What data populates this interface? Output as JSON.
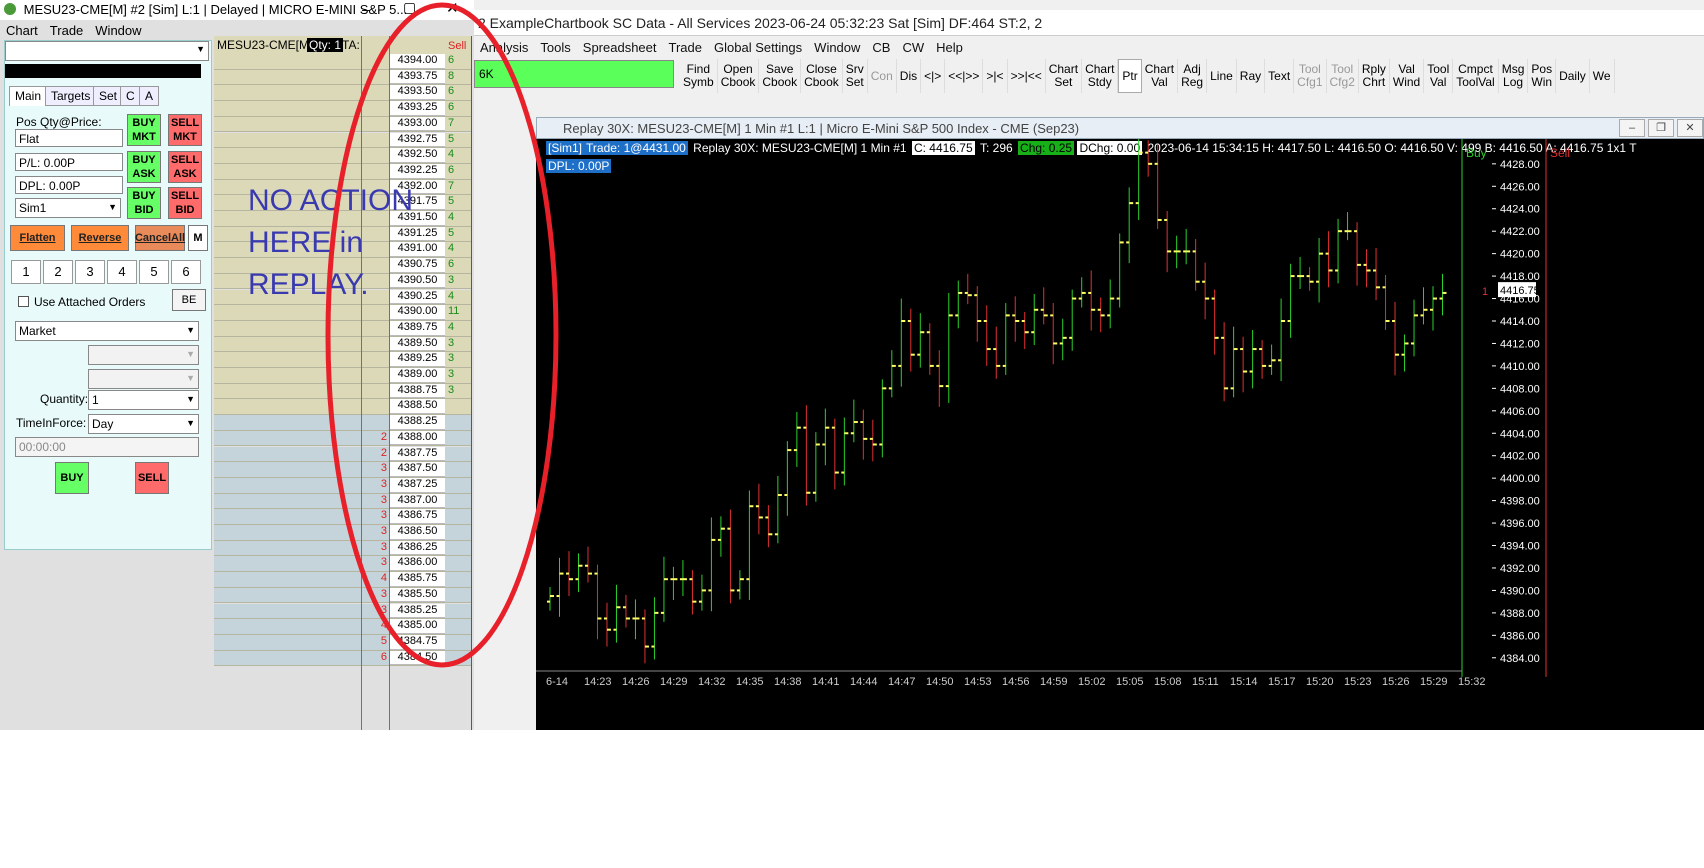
{
  "dom_window": {
    "title": "MESU23-CME[M] #2 [Sim]  L:1 | Delayed | MICRO E-MINI S&P 5...",
    "menu": [
      "Chart",
      "Trade",
      "Window"
    ],
    "header_symbol": "MESU23-CME[M]",
    "header_qty": "Qty: 1",
    "header_ta": "TA:",
    "sell_header": "Sell",
    "tabs": [
      "Main",
      "Targets",
      "Set",
      "C",
      "A"
    ],
    "pos_label": "Pos Qty@Price:",
    "pos_value": "Flat",
    "pl_value": "P/L: 0.00P",
    "dpl_value": "DPL: 0.00P",
    "account": "Sim1",
    "buy_mkt": "BUY MKT",
    "sell_mkt": "SELL MKT",
    "buy_ask": "BUY ASK",
    "sell_ask": "SELL ASK",
    "buy_bid": "BUY BID",
    "sell_bid": "SELL BID",
    "flatten": "Flatten",
    "reverse": "Reverse",
    "cancel_all": "CancelAll",
    "m_label": "M",
    "qty_buttons": [
      "1",
      "2",
      "3",
      "4",
      "5",
      "6"
    ],
    "attached_orders": "Use Attached Orders",
    "be_label": "BE",
    "order_type": "Market",
    "quantity_label": "Quantity:",
    "quantity_value": "1",
    "tif_label": "TimeInForce:",
    "tif_value": "Day",
    "time_value": "00:00:00",
    "buy": "BUY",
    "sell": "SELL",
    "note": [
      "NO ACTION",
      "HERE in",
      "REPLAY."
    ],
    "ladder_rows": [
      {
        "price": "4394.00",
        "ask": "6",
        "bid": ""
      },
      {
        "price": "4393.75",
        "ask": "8",
        "bid": ""
      },
      {
        "price": "4393.50",
        "ask": "6",
        "bid": ""
      },
      {
        "price": "4393.25",
        "ask": "6",
        "bid": ""
      },
      {
        "price": "4393.00",
        "ask": "7",
        "bid": ""
      },
      {
        "price": "4392.75",
        "ask": "5",
        "bid": ""
      },
      {
        "price": "4392.50",
        "ask": "4",
        "bid": ""
      },
      {
        "price": "4392.25",
        "ask": "6",
        "bid": ""
      },
      {
        "price": "4392.00",
        "ask": "7",
        "bid": ""
      },
      {
        "price": "4391.75",
        "ask": "5",
        "bid": ""
      },
      {
        "price": "4391.50",
        "ask": "4",
        "bid": ""
      },
      {
        "price": "4391.25",
        "ask": "5",
        "bid": ""
      },
      {
        "price": "4391.00",
        "ask": "4",
        "bid": ""
      },
      {
        "price": "4390.75",
        "ask": "6",
        "bid": ""
      },
      {
        "price": "4390.50",
        "ask": "3",
        "bid": ""
      },
      {
        "price": "4390.25",
        "ask": "4",
        "bid": ""
      },
      {
        "price": "4390.00",
        "ask": "11",
        "bid": ""
      },
      {
        "price": "4389.75",
        "ask": "4",
        "bid": ""
      },
      {
        "price": "4389.50",
        "ask": "3",
        "bid": ""
      },
      {
        "price": "4389.25",
        "ask": "3",
        "bid": ""
      },
      {
        "price": "4389.00",
        "ask": "3",
        "bid": ""
      },
      {
        "price": "4388.75",
        "ask": "3",
        "bid": ""
      },
      {
        "price": "4388.50",
        "ask": "",
        "bid": ""
      },
      {
        "price": "4388.25",
        "ask": "",
        "bid": ""
      },
      {
        "price": "4388.00",
        "ask": "",
        "bid": "2"
      },
      {
        "price": "4387.75",
        "ask": "",
        "bid": "2"
      },
      {
        "price": "4387.50",
        "ask": "",
        "bid": "3"
      },
      {
        "price": "4387.25",
        "ask": "",
        "bid": "3"
      },
      {
        "price": "4387.00",
        "ask": "",
        "bid": "3"
      },
      {
        "price": "4386.75",
        "ask": "",
        "bid": "3"
      },
      {
        "price": "4386.50",
        "ask": "",
        "bid": "3"
      },
      {
        "price": "4386.25",
        "ask": "",
        "bid": "3"
      },
      {
        "price": "4386.00",
        "ask": "",
        "bid": "3"
      },
      {
        "price": "4385.75",
        "ask": "",
        "bid": "4"
      },
      {
        "price": "4385.50",
        "ask": "",
        "bid": "3"
      },
      {
        "price": "4385.25",
        "ask": "",
        "bid": "3"
      },
      {
        "price": "4385.00",
        "ask": "",
        "bid": "4"
      },
      {
        "price": "4384.75",
        "ask": "",
        "bid": "5"
      },
      {
        "price": "4384.50",
        "ask": "",
        "bid": "6"
      }
    ]
  },
  "main_window": {
    "title": "2 ExampleChartbook SC Data - All Services 2023-06-24  05:32:23 Sat [Sim]  DF:464  ST:2, 2",
    "menu": [
      "Analysis",
      "Tools",
      "Spreadsheet",
      "Trade",
      "Global Settings",
      "Window",
      "CB",
      "CW",
      "Help"
    ],
    "green_box_text": "6K",
    "toolbar": [
      {
        "label": "Find\nSymb",
        "state": "normal"
      },
      {
        "label": "Open\nCbook",
        "state": "normal"
      },
      {
        "label": "Save\nCbook",
        "state": "normal"
      },
      {
        "label": "Close\nCbook",
        "state": "normal"
      },
      {
        "label": "Srv\nSet",
        "state": "normal"
      },
      {
        "label": "Con",
        "state": "disabled"
      },
      {
        "label": "Dis",
        "state": "normal"
      },
      {
        "label": "<|>",
        "state": "normal"
      },
      {
        "label": "<<|>>",
        "state": "normal"
      },
      {
        "label": ">|<",
        "state": "normal"
      },
      {
        "label": ">>|<<",
        "state": "normal"
      },
      {
        "label": "Chart\nSet",
        "state": "normal"
      },
      {
        "label": "Chart\nStdy",
        "state": "normal"
      },
      {
        "label": "Ptr",
        "state": "selected"
      },
      {
        "label": "Chart\nVal",
        "state": "normal"
      },
      {
        "label": "Adj\nReg",
        "state": "normal"
      },
      {
        "label": "Line",
        "state": "normal"
      },
      {
        "label": "Ray",
        "state": "normal"
      },
      {
        "label": "Text",
        "state": "normal"
      },
      {
        "label": "Tool\nCfg1",
        "state": "disabled"
      },
      {
        "label": "Tool\nCfg2",
        "state": "disabled"
      },
      {
        "label": "Rply\nChrt",
        "state": "normal"
      },
      {
        "label": "Val\nWind",
        "state": "normal"
      },
      {
        "label": "Tool\nVal",
        "state": "normal"
      },
      {
        "label": "Cmpct\nToolVal",
        "state": "normal"
      },
      {
        "label": "Msg\nLog",
        "state": "normal"
      },
      {
        "label": "Pos\nWin",
        "state": "normal"
      },
      {
        "label": "Daily",
        "state": "normal"
      },
      {
        "label": "We",
        "state": "normal"
      }
    ]
  },
  "chart_window": {
    "title": "Replay 30X: MESU23-CME[M]  1 Min  #1 L:1 | Micro E-Mini S&P 500 Index - CME (Sep23)",
    "info_sim": "[Sim1]",
    "info_trade": "Trade: 1@4431.00",
    "info_replay": "Replay 30X: MESU23-CME[M]  1 Min  #1",
    "info_c": "C: 4416.75",
    "info_t": "T: 296",
    "info_chg": "Chg: 0.25",
    "info_dchg": "DChg: 0.00",
    "info_rest": "2023-06-14 15:34:15 H: 4417.50 L: 4416.50 O: 4416.50 V: 499 B: 4416.50 A: 4416.75 1x1 T",
    "dpl": "DPL: 0.00P",
    "buy_label": "Buy",
    "sell_label": "Sell",
    "right_one": "1",
    "last_price": "4416.75",
    "date_label": "6-14",
    "colors": {
      "up": "#2bd12b",
      "down": "#e03030",
      "tick": "#ffff66"
    }
  },
  "chart_data": {
    "type": "ohlc",
    "title": "Replay 30X: MESU23-CME[M]  1 Min",
    "y_ticks": [
      "4428.00",
      "4426.00",
      "4424.00",
      "4422.00",
      "4420.00",
      "4418.00",
      "4416.00",
      "4414.00",
      "4412.00",
      "4410.00",
      "4408.00",
      "4406.00",
      "4404.00",
      "4402.00",
      "4400.00",
      "4398.00",
      "4396.00",
      "4394.00",
      "4392.00",
      "4390.00",
      "4388.00",
      "4386.00",
      "4384.00"
    ],
    "x_ticks": [
      "6-14",
      "14:23",
      "14:26",
      "14:29",
      "14:32",
      "14:35",
      "14:38",
      "14:41",
      "14:44",
      "14:47",
      "14:50",
      "14:53",
      "14:56",
      "14:59",
      "15:02",
      "15:05",
      "15:08",
      "15:11",
      "15:14",
      "15:17",
      "15:20",
      "15:23",
      "15:26",
      "15:29",
      "15:32"
    ],
    "ylim": [
      4383,
      4429.5
    ],
    "close": [
      4389.5,
      4391.5,
      4391,
      4392.2,
      4391.5,
      4387.5,
      4386.5,
      4388.5,
      4387.5,
      4387.5,
      4385,
      4388,
      4391,
      4391,
      4391,
      4389,
      4390,
      4394.5,
      4395.5,
      4390,
      4391,
      4397.5,
      4396.5,
      4395,
      4398.5,
      4402.5,
      4404.5,
      4398.7,
      4403,
      4404.5,
      4400.5,
      4404,
      4405,
      4403.5,
      4403,
      4408,
      4410,
      4414,
      4411,
      4413,
      4410,
      4408.2,
      4414.5,
      4416.5,
      4416.3,
      4414,
      4411.5,
      4410,
      4414.5,
      4414,
      4413,
      4415,
      4414.5,
      4412,
      4412.5,
      4416,
      4416.5,
      4415,
      4414.5,
      4416,
      4421,
      4424.5,
      4429,
      4428,
      4423,
      4420.2,
      4420.2,
      4420.2,
      4417.5,
      4416,
      4412.5,
      4408,
      4411.5,
      4409.5,
      4411.5,
      4410,
      4410.5,
      4414,
      4418,
      4418,
      4417.5,
      4420,
      4418.5,
      4422,
      4422,
      4419,
      4418.5,
      4417,
      4414,
      4411,
      4412,
      4414.5,
      4415,
      4416,
      4416.5
    ]
  }
}
